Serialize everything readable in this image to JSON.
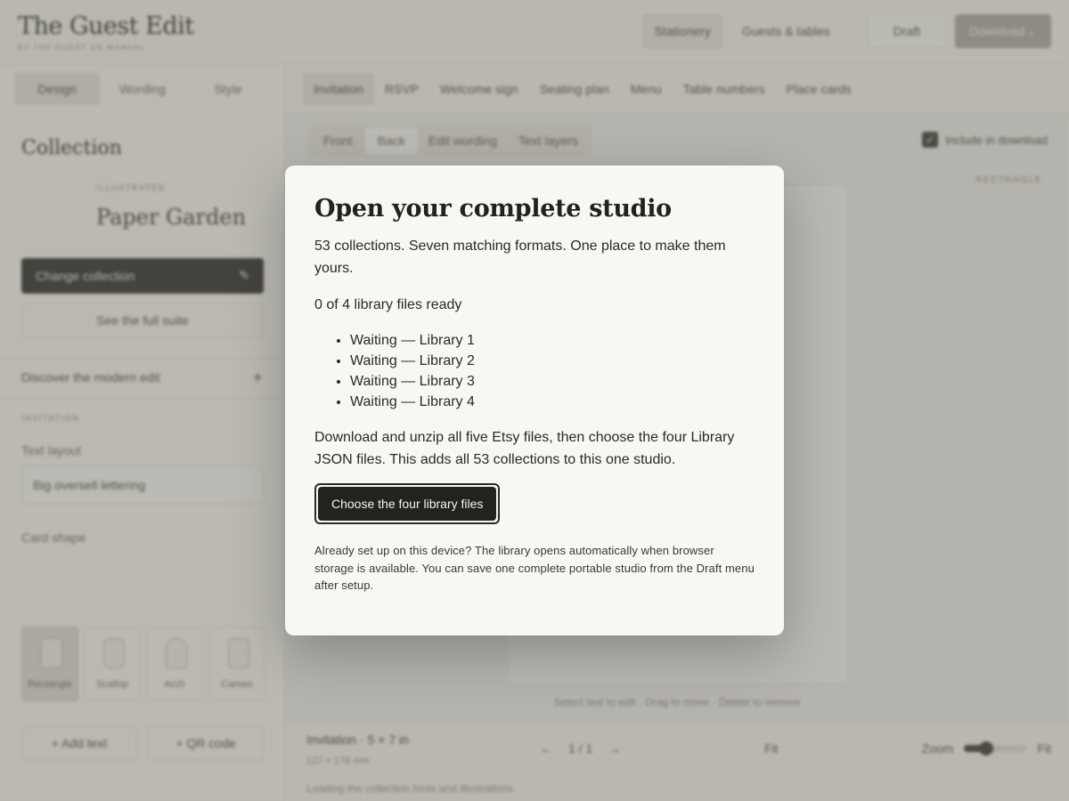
{
  "header": {
    "brand": "The Guest Edit",
    "brand_sub": "BY THE GUEST ON MANUAL",
    "nav": [
      "Stationery",
      "Guests & tables"
    ],
    "draft": "Draft",
    "download": "Download ↓"
  },
  "sidebar": {
    "tabs": [
      "Design",
      "Wording",
      "Style"
    ],
    "heading": "Collection",
    "collection_type": "ILLUSTRATED",
    "collection_name": "Paper Garden",
    "change_label": "Change collection",
    "suite_label": "See the full suite",
    "discover_label": "Discover the modern edit",
    "discover_toggle": "+",
    "section_label": "INVITATION",
    "text_layout_label": "Text layout",
    "text_layout_value": "Big oversell lettering",
    "card_shape_label": "Card shape",
    "shapes": [
      "Rectangle",
      "Scallop",
      "Arch",
      "Cameo"
    ],
    "add_text": "+ Add text",
    "qr_code": "+ QR code"
  },
  "formats": [
    "Invitation",
    "RSVP",
    "Welcome sign",
    "Seating plan",
    "Menu",
    "Table numbers",
    "Place cards"
  ],
  "canvas": {
    "subtabs": [
      "Front",
      "Back",
      "Edit wording",
      "Text layers"
    ],
    "include_label": "Include in download",
    "shape_label": "RECTANGLE",
    "hint": "Select text to edit · Drag to move · Delete to remove"
  },
  "bottom": {
    "title": "Invitation · 5 × 7 in",
    "size": "127 × 178 mm",
    "status": "Loading the collection fonts and illustrations",
    "prev": "←",
    "page": "1 / 1",
    "next": "→",
    "fit": "Fit",
    "zoom_label": "Zoom",
    "zoom_value": "Fit",
    "zoom_level": 0.35
  },
  "modal": {
    "title": "Open your complete studio",
    "lead": "53 collections. Seven matching formats. One place to make them yours.",
    "progress": "0 of 4 library files ready",
    "files": [
      "Waiting — Library 1",
      "Waiting — Library 2",
      "Waiting — Library 3",
      "Waiting — Library 4"
    ],
    "instructions": "Download and unzip all five Etsy files, then choose the four Library JSON files. This adds all 53 collections to this one studio.",
    "button": "Choose the four library files",
    "note": "Already set up on this device? The library opens automatically when browser storage is available. You can save one complete portable studio from the Draft menu after setup."
  }
}
